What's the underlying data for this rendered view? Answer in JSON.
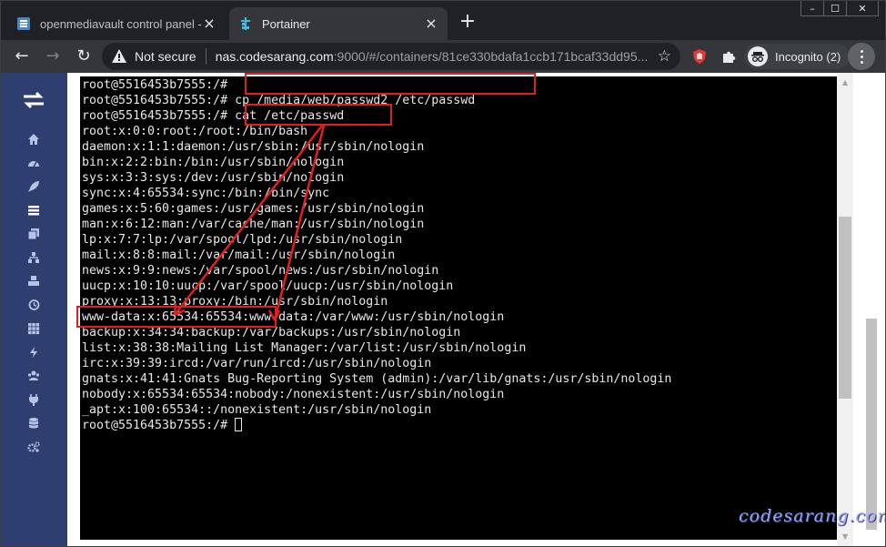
{
  "browser": {
    "tabs": [
      {
        "title": "openmediavault control panel - l",
        "active": false
      },
      {
        "title": "Portainer",
        "active": true
      }
    ],
    "new_tab_label": "+",
    "window_controls": {
      "minimize": "–",
      "maximize": "☐",
      "close": "✕"
    },
    "nav": {
      "back": "←",
      "forward": "→",
      "reload": "↻"
    },
    "security_label": "Not secure",
    "url_host": "nas.codesarang.com",
    "url_rest": ":9000/#/containers/81ce330bdafa1ccb171bcaf33dd95...",
    "incognito_label": "Incognito (2)",
    "colors": {
      "chrome_bg": "#202124",
      "toolbar_bg": "#35363a",
      "sidebar_bg": "#2e3e6e",
      "highlight": "#e02020"
    }
  },
  "sidebar": {
    "icons": [
      "swap-arrows-icon",
      "home-icon",
      "dashboard-gauge-icon",
      "rocket-icon",
      "list-icon",
      "copy-icon",
      "network-icon",
      "cubes-icon",
      "history-icon",
      "grid-icon",
      "bolt-icon",
      "users-icon",
      "plug-icon",
      "database-icon",
      "cogs-icon"
    ]
  },
  "terminal": {
    "lines": [
      "root@5516453b7555:/# ",
      "root@5516453b7555:/# ",
      "root@5516453b7555:/# ",
      "root:x:0:0:root:/root:/bin/bash",
      "daemon:x:1:1:daemon:/usr/sbin:/usr/sbin/nologin",
      "bin:x:2:2:bin:/bin:/usr/sbin/nologin",
      "sys:x:3:3:sys:/dev:/usr/sbin/nologin",
      "sync:x:4:65534:sync:/bin:/bin/sync",
      "games:x:5:60:games:/usr/games:/usr/sbin/nologin",
      "man:x:6:12:man:/var/cache/man:/usr/sbin/nologin",
      "lp:x:7:7:lp:/var/spool/lpd:/usr/sbin/nologin",
      "mail:x:8:8:mail:/var/mail:/usr/sbin/nologin",
      "news:x:9:9:news:/var/spool/news:/usr/sbin/nologin",
      "uucp:x:10:10:uucp:/var/spool/uucp:/usr/sbin/nologin",
      "proxy:x:13:13:proxy:/bin:/usr/sbin/nologin",
      "www-data:x:65534:65534:www-data:/var/www:/usr/sbin/nologin",
      "backup:x:34:34:backup:/var/backups:/usr/sbin/nologin",
      "list:x:38:38:Mailing List Manager:/var/list:/usr/sbin/nologin",
      "irc:x:39:39:ircd:/var/run/ircd:/usr/sbin/nologin",
      "gnats:x:41:41:Gnats Bug-Reporting System (admin):/var/lib/gnats:/usr/sbin/nologin",
      "nobody:x:65534:65534:nobody:/nonexistent:/usr/sbin/nologin",
      "_apt:x:100:65534::/nonexistent:/usr/sbin/nologin",
      "root@5516453b7555:/# "
    ],
    "cmd1": "cp /media/web/passwd2 /etc/passwd",
    "cmd2": "cat /etc/passwd"
  },
  "watermark": "codesarang.com"
}
